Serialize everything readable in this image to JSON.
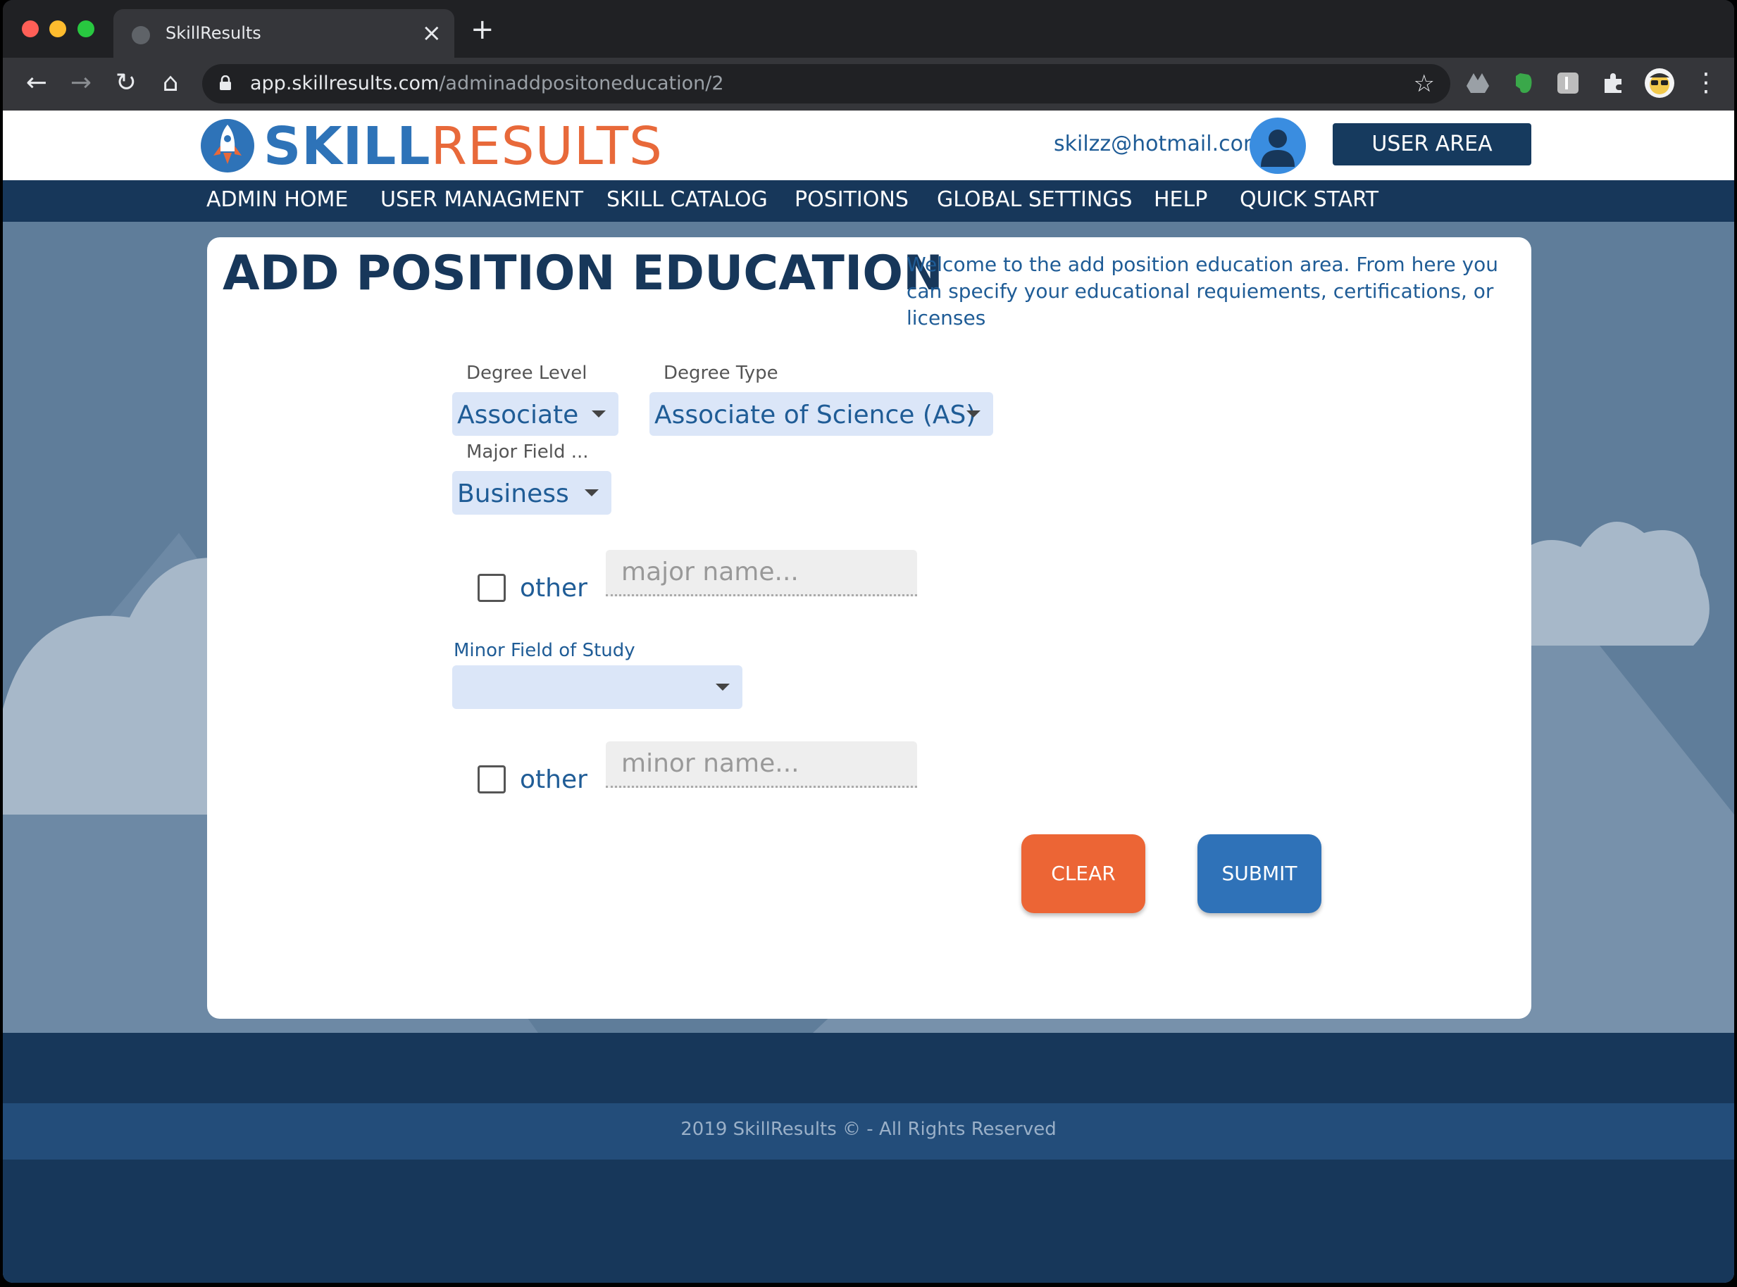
{
  "browser": {
    "tab_title": "SkillResults",
    "tab_close": "×",
    "new_tab": "+",
    "url_host": "app.skillresults.com",
    "url_path": "/adminaddpositoneducation/2",
    "back": "←",
    "forward": "→",
    "reload": "↻",
    "home": "⌂",
    "star": "☆",
    "menu": "⋮"
  },
  "header": {
    "logo_skill": "SKILL",
    "logo_results": "RESULTS",
    "user_email": "skilzz@hotmail.com",
    "user_area_label": "USER AREA"
  },
  "nav": {
    "items": [
      "ADMIN HOME",
      "USER MANAGMENT",
      "SKILL CATALOG",
      "POSITIONS",
      "GLOBAL SETTINGS",
      "HELP",
      "QUICK START"
    ]
  },
  "main": {
    "title": "ADD POSITION EDUCATION",
    "intro": "Welcome to the add position education area. From here you can specify your educational requiements, certifications, or licenses",
    "degree_level_label": "Degree Level",
    "degree_level_value": "Associate",
    "degree_type_label": "Degree Type",
    "degree_type_value": "Associate of Science (AS)",
    "major_label": "Major Field ...",
    "major_value": "Business",
    "major_other_label": "other",
    "major_placeholder": "major name...",
    "minor_label": "Minor Field of Study",
    "minor_value": "",
    "minor_other_label": "other",
    "minor_placeholder": "minor name...",
    "clear_label": "CLEAR",
    "submit_label": "SUBMIT"
  },
  "footer": {
    "copyright": "2019 SkillResults © - All Rights Reserved"
  },
  "colors": {
    "brand_blue": "#2e73b8",
    "brand_orange": "#e8693a",
    "navy": "#17375a",
    "clear": "#ec6535",
    "submit": "#2f72b8"
  }
}
